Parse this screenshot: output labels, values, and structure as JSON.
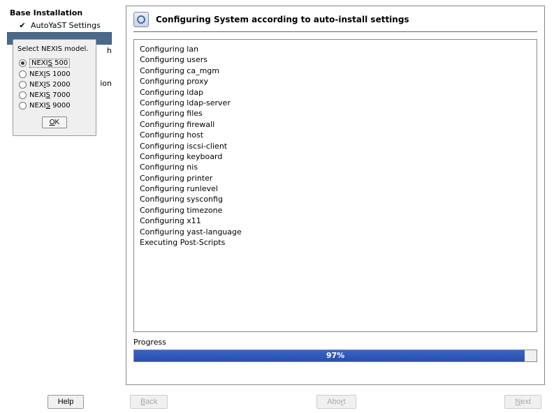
{
  "sidebar": {
    "title": "Base Installation",
    "item_checked": "AutoYaST Settings",
    "partial_suffix": "h",
    "partial_suffix2": "ion"
  },
  "dialog": {
    "label": "Select NEXIS model.",
    "options": [
      {
        "text": "NEXIS 500",
        "underlineIndex": 4,
        "selected": true
      },
      {
        "text": "NEXIS 1000",
        "underlineIndex": 3,
        "selected": false
      },
      {
        "text": "NEXIS 2000",
        "underlineIndex": 3,
        "selected": false
      },
      {
        "text": "NEXIS 7000",
        "underlineIndex": 4,
        "selected": false
      },
      {
        "text": "NEXIS 9000",
        "underlineIndex": 4,
        "selected": false
      }
    ],
    "ok_label": "OK",
    "ok_underline": 0
  },
  "main": {
    "title": "Configuring System according to auto-install settings",
    "log": [
      "Configuring lan",
      "Configuring users",
      "Configuring ca_mgm",
      "Configuring proxy",
      "Configuring ldap",
      "Configuring ldap-server",
      "Configuring files",
      "Configuring firewall",
      "Configuring host",
      "Configuring iscsi-client",
      "Configuring keyboard",
      "Configuring nis",
      "Configuring printer",
      "Configuring runlevel",
      "Configuring sysconfig",
      "Configuring timezone",
      "Configuring x11",
      "Configuring yast-language",
      "Executing Post-Scripts"
    ],
    "progress_label": "Progress",
    "progress_percent": 97
  },
  "buttons": {
    "help": "Help",
    "back": "Back",
    "abort": "Abort",
    "next": "Next"
  }
}
